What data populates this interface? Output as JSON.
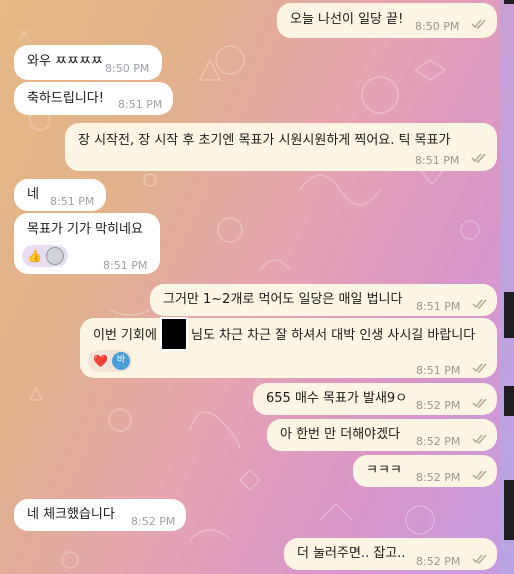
{
  "messages": [
    {
      "id": "m1",
      "side": "out",
      "text": "오늘 나선이 일당 끝!",
      "time": "8:50 PM"
    },
    {
      "id": "m2",
      "side": "in",
      "text": "와우 ㅉㅉㅉㅉ",
      "time": "8:50 PM"
    },
    {
      "id": "m3",
      "side": "in",
      "text": "축하드립니다!",
      "time": "8:51 PM"
    },
    {
      "id": "m4",
      "side": "out",
      "text": "장 시작전, 장 시작 후 초기엔 목표가 시원시원하게 찍어요. 틱 목표가",
      "time": "8:51 PM"
    },
    {
      "id": "m5",
      "side": "in",
      "text": "네",
      "time": "8:51 PM"
    },
    {
      "id": "m6",
      "side": "in",
      "text": "목표가 기가 막히네요",
      "time": "8:51 PM",
      "reaction": "👍"
    },
    {
      "id": "m7",
      "side": "out",
      "text": "그거만 1~2개로 먹어도 일당은 매일 법니다",
      "time": "8:51 PM"
    },
    {
      "id": "m8",
      "side": "out",
      "text_before": "이번 기회에",
      "text_after": "님도 차근 차근 잘 하셔서 대박 인생 사시길 바랍니다",
      "time": "8:51 PM",
      "reaction": "❤️",
      "reaction_user": "바"
    },
    {
      "id": "m9",
      "side": "out",
      "text": "655 매수 목표가 발새9ㅇ",
      "time": "8:52 PM"
    },
    {
      "id": "m10",
      "side": "out",
      "text": "아 한번 만 더해야겠다",
      "time": "8:52 PM"
    },
    {
      "id": "m11",
      "side": "out",
      "text": "ㅋㅋㅋ",
      "time": "8:52 PM"
    },
    {
      "id": "m12",
      "side": "in",
      "text": "네 체크했습니다",
      "time": "8:52 PM"
    },
    {
      "id": "m13",
      "side": "out",
      "text": "더 눌러주면.. 잡고..",
      "time": "8:52 PM"
    }
  ],
  "colors": {
    "incoming": "#ffffff",
    "outgoing": "#fdf5e4",
    "check": "#b7ab8f",
    "heart": "#e0243a",
    "reaction_bg": "#e8ddf2"
  },
  "icons": {
    "read_receipt": "double-check-icon",
    "thumbs": "thumbs-up-icon",
    "heart": "heart-icon"
  }
}
